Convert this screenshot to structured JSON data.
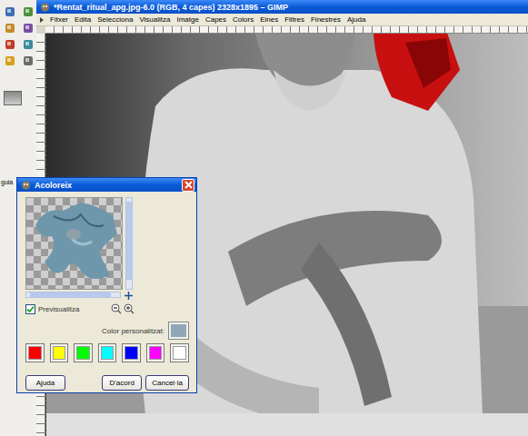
{
  "toolbox": {
    "label": "guia"
  },
  "image_window": {
    "title": "*Rentat_ritual_apg.jpg-6.0 (RGB, 4 capes) 2328x1895 – GIMP",
    "menu": [
      "Fitxer",
      "Edita",
      "Selecciona",
      "Visualitza",
      "Imatge",
      "Capes",
      "Colors",
      "Eines",
      "Filtres",
      "Finestres",
      "Ajuda"
    ]
  },
  "dialog": {
    "title": "Acoloreix",
    "preview": {
      "label": "Previsualitza",
      "checked": true
    },
    "custom_color": {
      "label": "Color personalitzat:",
      "color": "#8fa7b8"
    },
    "swatches": [
      {
        "color": "#ff0000"
      },
      {
        "color": "#ffff00"
      },
      {
        "color": "#00ff00"
      },
      {
        "color": "#00ffff"
      },
      {
        "color": "#0000ff"
      },
      {
        "color": "#ff00ff"
      },
      {
        "color": "#ffffff"
      }
    ],
    "buttons": [
      {
        "label": "Ajuda"
      },
      {
        "label": "D'acord"
      },
      {
        "label": "Cancel·la"
      }
    ]
  }
}
